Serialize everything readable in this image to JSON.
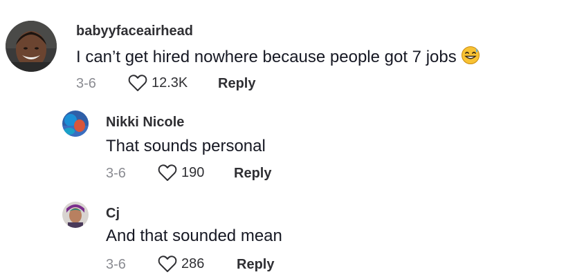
{
  "comments": [
    {
      "username": "babyyfaceairhead",
      "text": "I can’t get hired nowhere because people got 7 jobs",
      "emoji": "grinning-sweat-emoji",
      "date": "3-6",
      "likes": "12.3K",
      "reply_label": "Reply"
    },
    {
      "username": "Nikki Nicole",
      "text": "That sounds personal",
      "date": "3-6",
      "likes": "190",
      "reply_label": "Reply"
    },
    {
      "username": "Cj",
      "text": "And that sounded mean",
      "date": "3-6",
      "likes": "286",
      "reply_label": "Reply"
    }
  ],
  "icons": {
    "like": "heart-outline-icon"
  },
  "colors": {
    "text": "#161823",
    "username": "#2f2f33",
    "muted": "#8a8b91"
  }
}
